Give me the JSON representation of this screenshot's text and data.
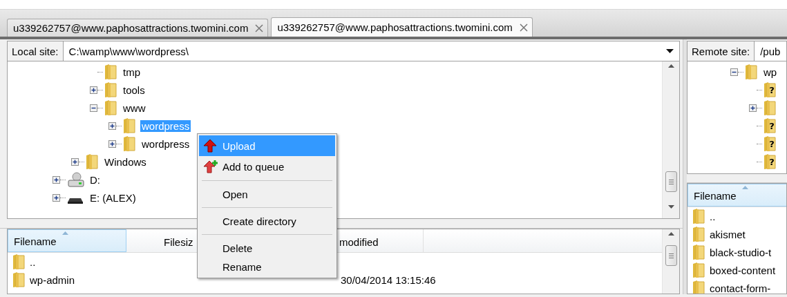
{
  "tabs": [
    {
      "label": "u339262757@www.paphosattractions.twomini.com",
      "selected": false
    },
    {
      "label": "u339262757@www.paphosattractions.twomini.com",
      "selected": true
    }
  ],
  "local_site": {
    "label": "Local site:",
    "path": "C:\\wamp\\www\\wordpress\\"
  },
  "local_tree": [
    {
      "children": [
        {
          "children": [
            {
              "label": "tmp",
              "kind": "folder",
              "selected": false
            },
            {
              "label": "tools",
              "kind": "folder",
              "expanded": false,
              "selected": false
            },
            {
              "label": "www",
              "kind": "folder",
              "expanded": true,
              "selected": false,
              "children": [
                {
                  "label": "wordpress",
                  "kind": "folder",
                  "expanded": false,
                  "selected": true
                },
                {
                  "label": "wordpress",
                  "kind": "folder",
                  "expanded": false,
                  "selected": false
                }
              ]
            }
          ]
        },
        {
          "label": "Windows",
          "kind": "folder",
          "expanded": false,
          "selected": false
        }
      ]
    },
    {
      "label": "D:",
      "kind": "drive",
      "expanded": false,
      "selected": false
    },
    {
      "label": "E: (ALEX)",
      "kind": "removable",
      "expanded": false,
      "selected": false
    }
  ],
  "local_files": {
    "columns": [
      {
        "label": "Filename",
        "sorted": true
      },
      {
        "label": "Filesiz",
        "sorted": false
      },
      {
        "label": "modified",
        "sorted": false
      }
    ],
    "rows": [
      {
        "name": ".."
      },
      {
        "name": "wp-admin",
        "modified": "30/04/2014 13:15:46"
      }
    ]
  },
  "remote_site": {
    "label": "Remote site:",
    "path": "/pub"
  },
  "remote_tree": [
    {
      "label": "wp",
      "kind": "folder",
      "expanded": true,
      "selected": false,
      "children": [
        {
          "kind": "unknown",
          "glyph": "?"
        },
        {
          "kind": "folder",
          "expanded": false
        },
        {
          "kind": "unknown",
          "glyph": "?"
        },
        {
          "kind": "unknown",
          "glyph": "?"
        },
        {
          "kind": "unknown",
          "glyph": "?"
        }
      ]
    }
  ],
  "remote_files": {
    "columns": [
      {
        "label": "Filename",
        "sorted": true
      }
    ],
    "rows": [
      {
        "name": ".."
      },
      {
        "name": "akismet"
      },
      {
        "name": "black-studio-t"
      },
      {
        "name": "boxed-content"
      },
      {
        "name": "contact-form-"
      }
    ]
  },
  "context_menu": [
    {
      "kind": "upload",
      "label": "Upload",
      "selected": true
    },
    {
      "kind": "queue",
      "label": "Add to queue",
      "selected": false
    },
    {
      "kind": "separator"
    },
    {
      "kind": "item",
      "label": "Open",
      "selected": false
    },
    {
      "kind": "separator"
    },
    {
      "kind": "item",
      "label": "Create directory",
      "selected": false
    },
    {
      "kind": "separator"
    },
    {
      "kind": "item",
      "label": "Delete",
      "selected": false
    },
    {
      "kind": "item",
      "label": "Rename",
      "selected": false
    }
  ]
}
